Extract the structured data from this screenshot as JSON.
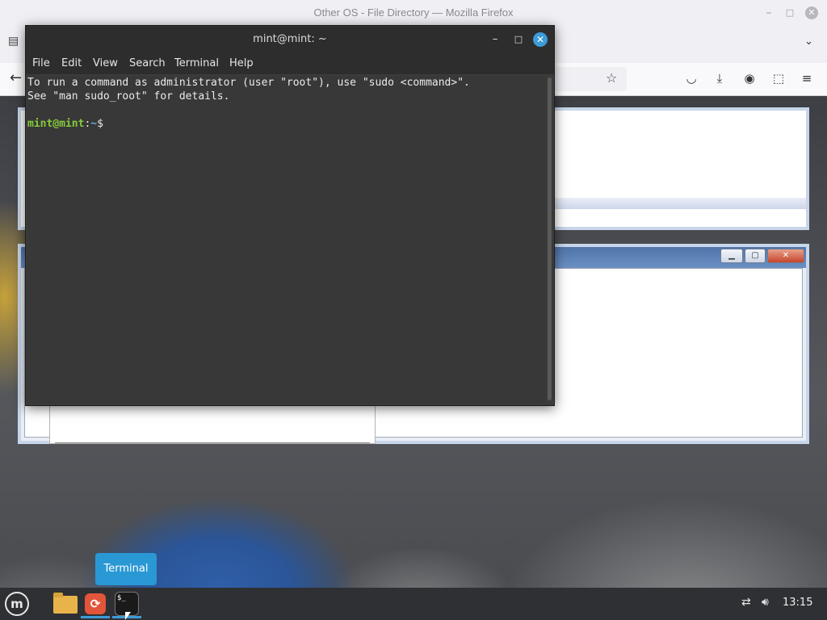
{
  "firefox": {
    "window_title": "Other OS - File Directory — Mozilla Firefox",
    "min_icon": "minimize-icon",
    "max_icon": "maximize-icon",
    "close_icon": "close-icon"
  },
  "terminal": {
    "title": "mint@mint: ~",
    "menu": [
      "File",
      "Edit",
      "View",
      "Search",
      "Terminal",
      "Help"
    ],
    "lines": [
      "To run a command as administrator (user \"root\"), use \"sudo <command>\".",
      "See \"man sudo_root\" for details."
    ],
    "prompt_user": "mint@mint",
    "prompt_sep": ":",
    "prompt_path": "~",
    "prompt_end": "$"
  },
  "taskbar": {
    "tooltip": "Terminal",
    "clock": "13:15",
    "apps": [
      "files-icon",
      "firefox-icon",
      "terminal-icon"
    ]
  }
}
